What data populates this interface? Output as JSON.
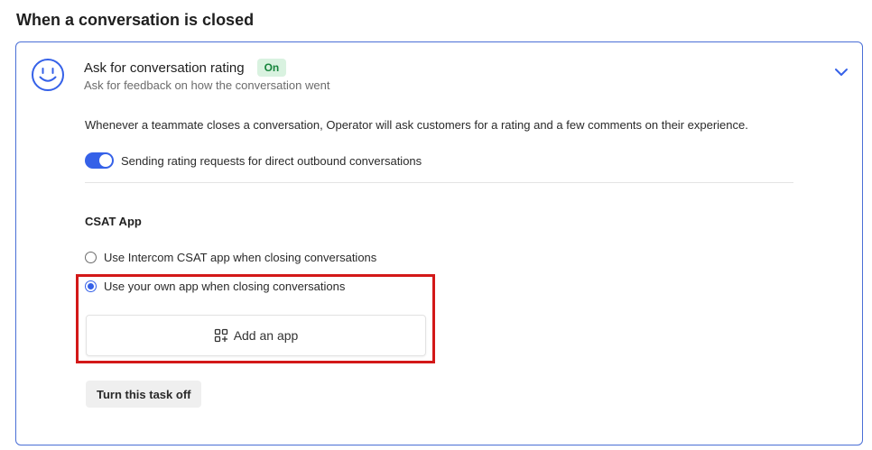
{
  "section": {
    "title": "When a conversation is closed"
  },
  "rating": {
    "title": "Ask for conversation rating",
    "badge": "On",
    "subtitle": "Ask for feedback on how the conversation went",
    "description": "Whenever a teammate closes a conversation, Operator will ask customers for a rating and a few comments on their experience.",
    "toggle_label": "Sending rating requests for direct outbound conversations",
    "toggle_on": true
  },
  "csat": {
    "heading": "CSAT App",
    "options": [
      {
        "label": "Use Intercom CSAT app when closing conversations",
        "selected": false
      },
      {
        "label": "Use your own app when closing conversations",
        "selected": true
      }
    ],
    "add_app_label": "Add an app"
  },
  "actions": {
    "turn_off_label": "Turn this task off"
  },
  "colors": {
    "accent": "#3561e8",
    "card_border": "#4a6fd6",
    "badge_bg": "#d9f2e0",
    "badge_text": "#17853c",
    "highlight": "#d31818"
  },
  "icons": {
    "header": "smiley-face-icon",
    "expand": "chevron-down-icon",
    "add_app": "apps-grid-plus-icon"
  }
}
